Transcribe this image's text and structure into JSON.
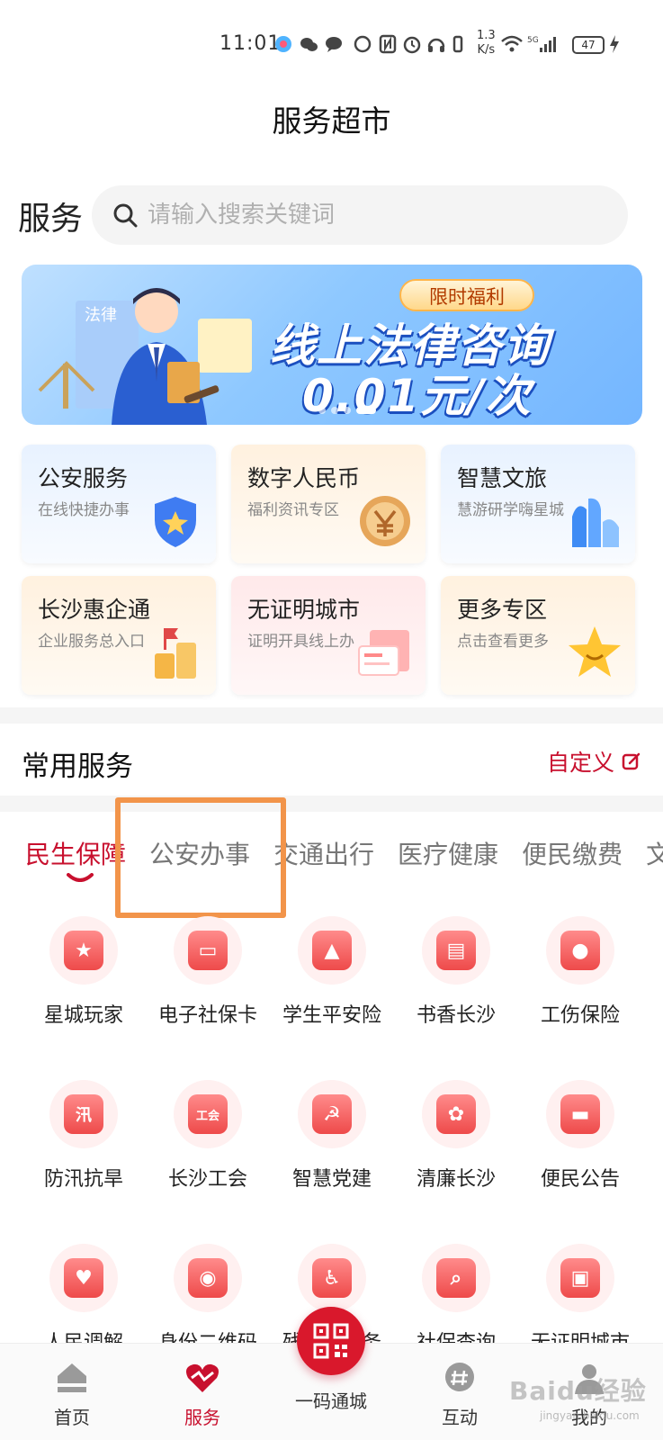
{
  "status_bar": {
    "time": "11:01",
    "network_speed_value": "1.3",
    "network_speed_unit": "K/s",
    "battery": "47"
  },
  "page": {
    "title": "服务超市"
  },
  "search": {
    "section_label": "服务",
    "placeholder": "请输入搜索关键词"
  },
  "banner": {
    "tag": "限时福利",
    "headline": "线上法律咨询",
    "price": "0.01元/次",
    "figure_sign": "法律"
  },
  "tiles": [
    {
      "title": "公安服务",
      "subtitle": "在线快捷办事"
    },
    {
      "title": "数字人民币",
      "subtitle": "福利资讯专区"
    },
    {
      "title": "智慧文旅",
      "subtitle": "慧游研学嗨星城"
    },
    {
      "title": "长沙惠企通",
      "subtitle": "企业服务总入口"
    },
    {
      "title": "无证明城市",
      "subtitle": "证明开具线上办"
    },
    {
      "title": "更多专区",
      "subtitle": "点击查看更多"
    }
  ],
  "common_services": {
    "title": "常用服务",
    "customize_label": "自定义"
  },
  "tabs": [
    "民生保障",
    "公安办事",
    "交通出行",
    "医疗健康",
    "便民缴费",
    "文"
  ],
  "services": [
    {
      "label": "星城玩家",
      "icon": "star-icon",
      "glyph": "★"
    },
    {
      "label": "电子社保卡",
      "icon": "card-icon",
      "glyph": "▭"
    },
    {
      "label": "学生平安险",
      "icon": "graduation-cap-icon",
      "glyph": "▲"
    },
    {
      "label": "书香长沙",
      "icon": "book-icon",
      "glyph": "▤"
    },
    {
      "label": "工伤保险",
      "icon": "worker-icon",
      "glyph": "●"
    },
    {
      "label": "防汛抗旱",
      "icon": "flood-tag-icon",
      "glyph": "汛"
    },
    {
      "label": "长沙工会",
      "icon": "union-card-icon",
      "glyph": "工会"
    },
    {
      "label": "智慧党建",
      "icon": "party-flag-icon",
      "glyph": "☭"
    },
    {
      "label": "清廉长沙",
      "icon": "lotus-icon",
      "glyph": "✿"
    },
    {
      "label": "便民公告",
      "icon": "notice-icon",
      "glyph": "▬"
    },
    {
      "label": "人民调解",
      "icon": "handshake-icon",
      "glyph": "♥"
    },
    {
      "label": "身份二维码",
      "icon": "id-shield-icon",
      "glyph": "◉"
    },
    {
      "label": "残疾人服务",
      "icon": "wheelchair-icon",
      "glyph": "♿"
    },
    {
      "label": "社保查询",
      "icon": "search-shield-icon",
      "glyph": "⌕"
    },
    {
      "label": "无证明城市",
      "icon": "certificate-icon",
      "glyph": "▣"
    }
  ],
  "bottom_nav": [
    {
      "label": "首页",
      "icon": "home-icon"
    },
    {
      "label": "服务",
      "icon": "heart-service-icon"
    },
    {
      "label": "一码通城",
      "icon": "qr-code-icon"
    },
    {
      "label": "互动",
      "icon": "chat-hash-icon"
    },
    {
      "label": "我的",
      "icon": "profile-icon"
    }
  ],
  "watermark": {
    "text": "Baidu经验",
    "sub": "jingyan.baidu.com"
  },
  "colors": {
    "accent": "#c8102e",
    "highlight_box": "#f2944a",
    "banner_blue": "#74b6ff"
  }
}
